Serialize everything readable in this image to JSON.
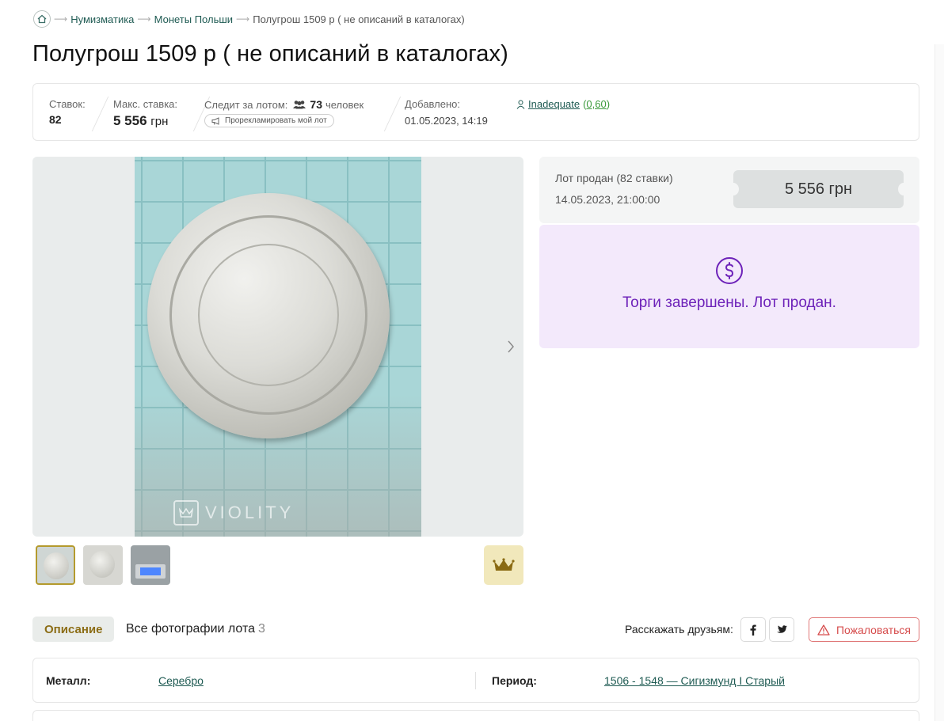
{
  "breadcrumb": {
    "items": [
      "Нумизматика",
      "Монеты Польши"
    ],
    "current": "Полугрош 1509 р ( не описаний в каталогах)"
  },
  "page_title": "Полугрош 1509 р ( не описаний в каталогах)",
  "stats": {
    "bids_label": "Ставок:",
    "bids_value": "82",
    "max_bid_label": "Макс. ставка:",
    "max_bid_amount": "5 556",
    "max_bid_unit": "грн",
    "watchers_label": "Следит за лотом:",
    "watchers_count": "73",
    "watchers_unit": "человек",
    "promote_label": "Прорекламировать мой лот",
    "added_label": "Добавлено:",
    "added_value": "01.05.2023, 14:19",
    "seller_name": "Inadequate",
    "seller_rating": "0,60"
  },
  "gallery": {
    "watermark": "VIOLITY",
    "photo_count": 3
  },
  "result": {
    "sold_label": "Лот продан (82 ставки)",
    "sold_date": "14.05.2023, 21:00:00",
    "final_price": "5 556 грн",
    "status_text": "Торги завершены. Лот продан."
  },
  "tabs": {
    "description": "Описание",
    "all_photos": "Все фотографии лота",
    "all_photos_count": "3"
  },
  "share": {
    "label": "Расскажать друзьям:",
    "report": "Пожаловаться"
  },
  "properties": [
    {
      "label": "Металл:",
      "value": "Серебро"
    },
    {
      "label": "Период:",
      "value": "1506 - 1548 — Сигизмунд I Старый"
    }
  ],
  "colors": {
    "link": "#1f5b53",
    "status_purple": "#6d22b9",
    "status_bg": "#f3e9fb",
    "report_red": "#d64c4c",
    "active_tab_text": "#8c6d16"
  }
}
